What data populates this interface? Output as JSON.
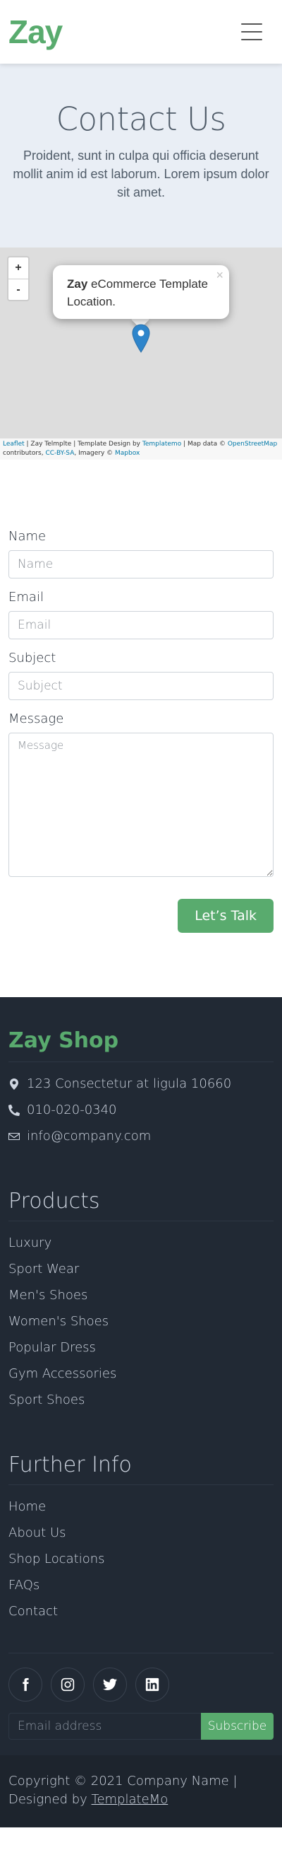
{
  "header": {
    "brand": "Zay",
    "menu_icon": "hamburger-icon"
  },
  "hero": {
    "title": "Contact Us",
    "text": "Proident, sunt in culpa qui officia deserunt mollit anim id est laborum. Lorem ipsum dolor sit amet."
  },
  "map": {
    "zoom_in": "+",
    "zoom_out": "-",
    "popup_strong": "Zay",
    "popup_text": " eCommerce Template Location.",
    "popup_close": "×",
    "attribution": {
      "leaflet": "Leaflet",
      "part1": " | Zay Telmplte | Template Design by ",
      "templatemo": "Templatemo",
      "part2": " | Map data © ",
      "osm": "OpenStreetMap",
      "part3": " contributors, ",
      "ccbysa": "CC-BY-SA",
      "part4": ", Imagery © ",
      "mapbox": "Mapbox"
    }
  },
  "form": {
    "name_label": "Name",
    "name_placeholder": "Name",
    "email_label": "Email",
    "email_placeholder": "Email",
    "subject_label": "Subject",
    "subject_placeholder": "Subject",
    "message_label": "Message",
    "message_placeholder": "Message",
    "submit": "Let’s Talk"
  },
  "footer": {
    "brand": "Zay Shop",
    "contacts": [
      {
        "icon": "map-marker-icon",
        "text": "123 Consectetur at ligula 10660"
      },
      {
        "icon": "phone-icon",
        "text": "010-020-0340"
      },
      {
        "icon": "envelope-icon",
        "text": "info@company.com"
      }
    ],
    "products_title": "Products",
    "products": [
      "Luxury",
      "Sport Wear",
      "Men's Shoes",
      "Women's Shoes",
      "Popular Dress",
      "Gym Accessories",
      "Sport Shoes"
    ],
    "further_title": "Further Info",
    "further": [
      "Home",
      "About Us",
      "Shop Locations",
      "FAQs",
      "Contact"
    ],
    "social_icons": [
      "facebook-icon",
      "instagram-icon",
      "twitter-icon",
      "linkedin-icon"
    ],
    "email_placeholder": "Email address",
    "subscribe": "Subscribe",
    "copyright_text": "Copyright © 2021 Company Name | Designed by ",
    "copyright_link": "TemplateMo"
  },
  "colors": {
    "accent": "#59ab6e",
    "footer_bg": "#212934",
    "hero_bg": "#e9eef5",
    "text_dark": "#212934"
  }
}
